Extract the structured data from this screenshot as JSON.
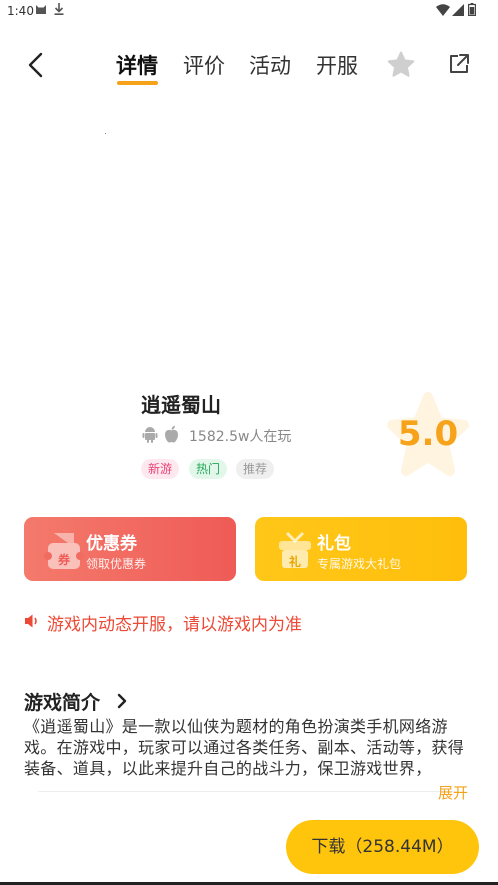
{
  "status_bar": {
    "time": "1:40"
  },
  "nav": {
    "tabs": [
      {
        "label": "详情",
        "active": true
      },
      {
        "label": "评价",
        "active": false
      },
      {
        "label": "活动",
        "active": false
      },
      {
        "label": "开服",
        "active": false
      }
    ],
    "accent": "#f7a21b"
  },
  "game": {
    "name": "逍遥蜀山",
    "players": "1582.5w人在玩",
    "tags": [
      "新游",
      "热门",
      "推荐"
    ],
    "score": "5.0"
  },
  "cards": {
    "coupon": {
      "title": "优惠券",
      "subtitle": "领取优惠券",
      "icon_char": "券"
    },
    "gift": {
      "title": "礼包",
      "subtitle": "专属游戏大礼包",
      "icon_char": "礼"
    }
  },
  "notice": {
    "text": "游戏内动态开服，请以游戏内为准"
  },
  "intro": {
    "title": "游戏简介",
    "body": "《逍遥蜀山》是一款以仙侠为题材的角色扮演类手机网络游戏。在游戏中，玩家可以通过各类任务、副本、活动等，获得装备、道具，以此来提升自己的战斗力，保卫游戏世界，",
    "expand": "展开"
  },
  "download": {
    "label": "下载（258.44M）"
  },
  "colors": {
    "coupon": "#ef5b56",
    "gift": "#ffc40c",
    "notice": "#ec4a36"
  }
}
